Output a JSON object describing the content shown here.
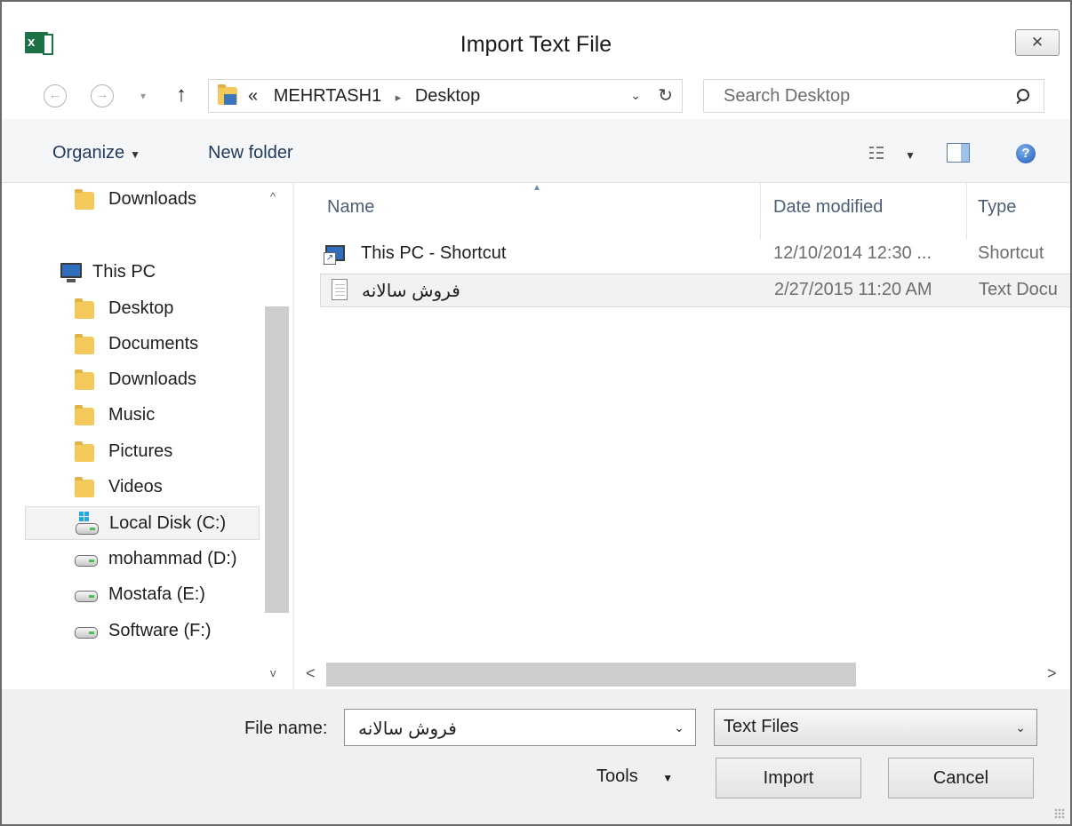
{
  "window": {
    "title": "Import Text File",
    "close_glyph": "✕",
    "app_icon_letter": "x"
  },
  "address_bar": {
    "back_glyph": "←",
    "forward_glyph": "→",
    "history_glyph": "▾",
    "up_glyph": "↑",
    "overflow_glyph": "«",
    "crumbs": [
      "MEHRTASH1",
      "Desktop"
    ],
    "crumb_separator": "▸",
    "dropdown_glyph": "⌄",
    "refresh_glyph": "↻"
  },
  "search": {
    "placeholder": "Search Desktop"
  },
  "toolbar": {
    "organize_label": "Organize",
    "organize_caret": "▼",
    "new_folder_label": "New folder",
    "view_caret": "▼",
    "help_glyph": "?"
  },
  "nav_pane": {
    "scroll_up_glyph": "^",
    "scroll_down_glyph": "v",
    "items": [
      {
        "label": "Downloads",
        "icon": "downloads-folder-icon"
      },
      {
        "label": "This PC",
        "icon": "computer-icon"
      },
      {
        "label": "Desktop",
        "icon": "desktop-folder-icon"
      },
      {
        "label": "Documents",
        "icon": "documents-folder-icon"
      },
      {
        "label": "Downloads",
        "icon": "downloads-folder-icon"
      },
      {
        "label": "Music",
        "icon": "music-folder-icon"
      },
      {
        "label": "Pictures",
        "icon": "pictures-folder-icon"
      },
      {
        "label": "Videos",
        "icon": "videos-folder-icon"
      },
      {
        "label": "Local Disk (C:)",
        "icon": "windows-drive-icon",
        "selected": true
      },
      {
        "label": "mohammad (D:)",
        "icon": "drive-icon"
      },
      {
        "label": "Mostafa (E:)",
        "icon": "drive-icon"
      },
      {
        "label": "Software (F:)",
        "icon": "drive-icon"
      }
    ]
  },
  "file_list": {
    "columns": [
      "Name",
      "Date modified",
      "Type"
    ],
    "sort_glyph": "▲",
    "rows": [
      {
        "name": "This PC - Shortcut",
        "date": "12/10/2014 12:30 ...",
        "type": "Shortcut",
        "icon": "shortcut-icon"
      },
      {
        "name": "فروش سالانه",
        "date": "2/27/2015 11:20 AM",
        "type": "Text Docu",
        "icon": "text-document-icon",
        "selected": true
      }
    ],
    "scroll_left_glyph": "<",
    "scroll_right_glyph": ">"
  },
  "footer": {
    "file_name_label": "File name:",
    "file_name_value": "فروش سالانه",
    "dropdown_glyph": "⌄",
    "file_type_value": "Text Files",
    "tools_label": "Tools",
    "tools_caret": "▼",
    "import_label": "Import",
    "cancel_label": "Cancel"
  },
  "colors": {
    "accent_blue": "#1e395b",
    "folder_yellow": "#f2c95a",
    "excel_green": "#1d7145"
  }
}
